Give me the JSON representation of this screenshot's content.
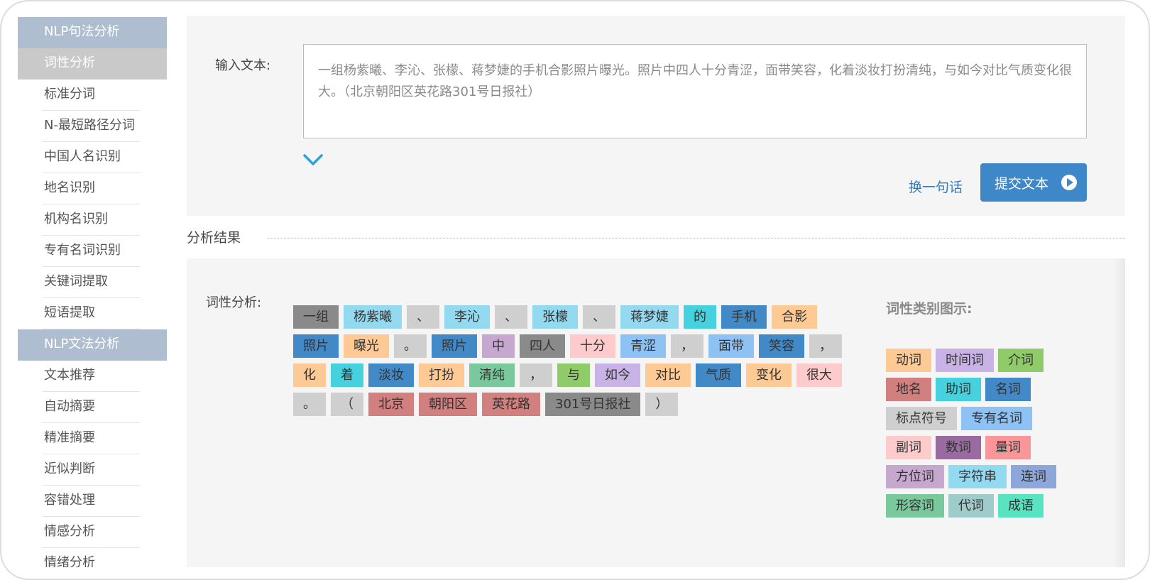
{
  "sidebar": {
    "items": [
      {
        "label": "NLP句法分析",
        "kind": "category"
      },
      {
        "label": "词性分析",
        "kind": "active"
      },
      {
        "label": "标准分词",
        "kind": "item"
      },
      {
        "label": "N-最短路径分词",
        "kind": "item"
      },
      {
        "label": "中国人名识别",
        "kind": "item"
      },
      {
        "label": "地名识别",
        "kind": "item"
      },
      {
        "label": "机构名识别",
        "kind": "item"
      },
      {
        "label": "专有名词识别",
        "kind": "item"
      },
      {
        "label": "关键词提取",
        "kind": "item"
      },
      {
        "label": "短语提取",
        "kind": "item"
      },
      {
        "label": "NLP文法分析",
        "kind": "category"
      },
      {
        "label": "文本推荐",
        "kind": "item"
      },
      {
        "label": "自动摘要",
        "kind": "item"
      },
      {
        "label": "精准摘要",
        "kind": "item"
      },
      {
        "label": "近似判断",
        "kind": "item"
      },
      {
        "label": "容错处理",
        "kind": "item"
      },
      {
        "label": "情感分析",
        "kind": "item"
      },
      {
        "label": "情绪分析",
        "kind": "item"
      }
    ]
  },
  "input": {
    "label": "输入文本:",
    "text": "一组杨紫曦、李沁、张檬、蒋梦婕的手机合影照片曝光。照片中四人十分青涩，面带笑容，化着淡妆打扮清纯，与如今对比气质变化很大。（北京朝阳区英花路301号日报社）",
    "change_link": "换一句话",
    "submit_label": "提交文本"
  },
  "result": {
    "title": "分析结果",
    "pos_label": "词性分析:",
    "legend_title": "词性类别图示:"
  },
  "categories": {
    "verb": {
      "label": "动词",
      "color": "#fdc995"
    },
    "time": {
      "label": "时间词",
      "color": "#c8b2e6"
    },
    "prep": {
      "label": "介词",
      "color": "#8fcb68"
    },
    "place": {
      "label": "地名",
      "color": "#d17f7f"
    },
    "aux": {
      "label": "助词",
      "color": "#45d2de"
    },
    "noun": {
      "label": "名词",
      "color": "#4289c7"
    },
    "punct": {
      "label": "标点符号",
      "color": "#cfcfcf"
    },
    "proper": {
      "label": "专有名词",
      "color": "#8ec1f4"
    },
    "adv": {
      "label": "副词",
      "color": "#fdcbcb"
    },
    "num": {
      "label": "数词",
      "color": "#9a6ba0"
    },
    "quant": {
      "label": "量词",
      "color": "#f8969a"
    },
    "loc": {
      "label": "方位词",
      "color": "#c6a8cf"
    },
    "str": {
      "label": "字符串",
      "color": "#93d9f0"
    },
    "conj": {
      "label": "连词",
      "color": "#8ea7db"
    },
    "adj": {
      "label": "形容词",
      "color": "#79c99c"
    },
    "pron": {
      "label": "代词",
      "color": "#9fcccb"
    },
    "idiom": {
      "label": "成语",
      "color": "#59e4c1"
    },
    "gray": {
      "label": "",
      "color": "#8a8a8a"
    }
  },
  "tokens": [
    {
      "text": "一组",
      "cat": "gray"
    },
    {
      "text": "杨紫曦",
      "cat": "str"
    },
    {
      "text": "、",
      "cat": "punct"
    },
    {
      "text": "李沁",
      "cat": "str"
    },
    {
      "text": "、",
      "cat": "punct"
    },
    {
      "text": "张檬",
      "cat": "str"
    },
    {
      "text": "、",
      "cat": "punct"
    },
    {
      "text": "蒋梦婕",
      "cat": "str"
    },
    {
      "text": "的",
      "cat": "aux"
    },
    {
      "text": "手机",
      "cat": "noun"
    },
    {
      "text": "合影",
      "cat": "verb"
    },
    {
      "text": "照片",
      "cat": "noun"
    },
    {
      "text": "曝光",
      "cat": "verb"
    },
    {
      "text": "。",
      "cat": "punct"
    },
    {
      "text": "照片",
      "cat": "noun"
    },
    {
      "text": "中",
      "cat": "loc"
    },
    {
      "text": "四人",
      "cat": "gray"
    },
    {
      "text": "十分",
      "cat": "adv"
    },
    {
      "text": "青涩",
      "cat": "proper"
    },
    {
      "text": "，",
      "cat": "punct"
    },
    {
      "text": "面带",
      "cat": "proper"
    },
    {
      "text": "笑容",
      "cat": "noun"
    },
    {
      "text": "，",
      "cat": "punct"
    },
    {
      "text": "化",
      "cat": "verb"
    },
    {
      "text": "着",
      "cat": "aux"
    },
    {
      "text": "淡妆",
      "cat": "noun"
    },
    {
      "text": "打扮",
      "cat": "verb"
    },
    {
      "text": "清纯",
      "cat": "adj"
    },
    {
      "text": "，",
      "cat": "punct"
    },
    {
      "text": "与",
      "cat": "prep"
    },
    {
      "text": "如今",
      "cat": "time"
    },
    {
      "text": "对比",
      "cat": "verb"
    },
    {
      "text": "气质",
      "cat": "noun"
    },
    {
      "text": "变化",
      "cat": "verb"
    },
    {
      "text": "很大",
      "cat": "adv"
    },
    {
      "text": "。",
      "cat": "punct"
    },
    {
      "text": "（",
      "cat": "punct"
    },
    {
      "text": "北京",
      "cat": "place"
    },
    {
      "text": "朝阳区",
      "cat": "place"
    },
    {
      "text": "英花路",
      "cat": "place"
    },
    {
      "text": "301号日报社",
      "cat": "gray"
    },
    {
      "text": "）",
      "cat": "punct"
    }
  ],
  "legend": [
    "verb",
    "time",
    "prep",
    "place",
    "aux",
    "noun",
    "punct",
    "proper",
    "adv",
    "num",
    "quant",
    "loc",
    "str",
    "conj",
    "adj",
    "pron",
    "idiom"
  ]
}
